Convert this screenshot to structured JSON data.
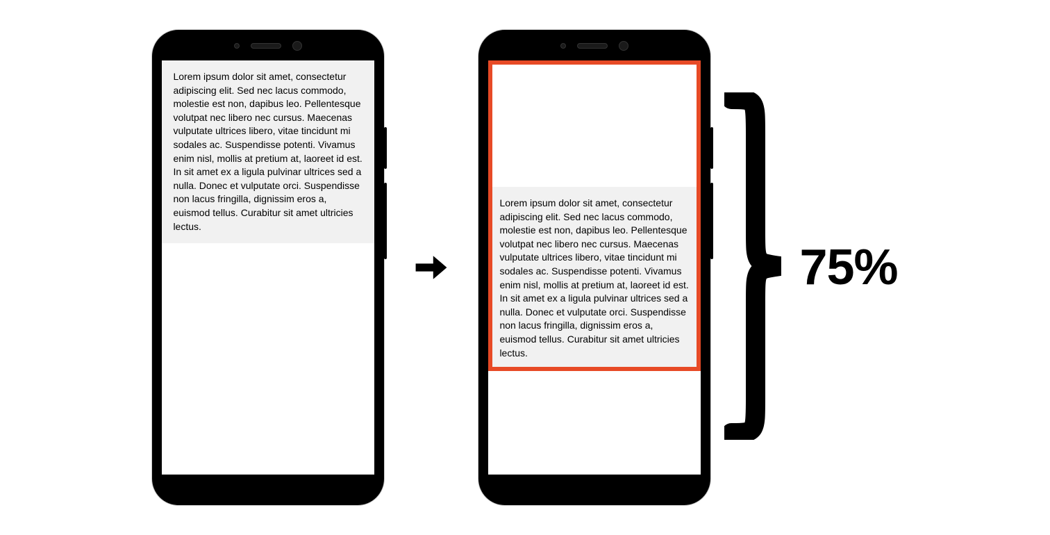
{
  "lorem_text": "Lorem ipsum dolor sit amet, consectetur adipiscing elit. Sed nec lacus commodo, molestie est non, dapibus leo. Pellentesque volutpat nec libero nec cursus. Maecenas vulputate ultrices libero, vitae tincidunt mi sodales ac. Suspendisse potenti. Vivamus enim nisl, mollis at pretium at, laoreet id est. In sit amet ex a ligula pulvinar ultrices sed a nulla. Donec et vulputate orci. Suspendisse non lacus fringilla, dignissim eros a, euismod tellus. Curabitur sit amet ultricies lectus.",
  "percent_label": "75%",
  "overlay_percent": 75,
  "colors": {
    "overlay_border": "#e74a26",
    "text_block_bg": "#f1f1f1",
    "phone_frame": "#000000"
  },
  "icons": {
    "arrow": "arrow-right-icon",
    "brace": "curly-brace-right-icon"
  }
}
